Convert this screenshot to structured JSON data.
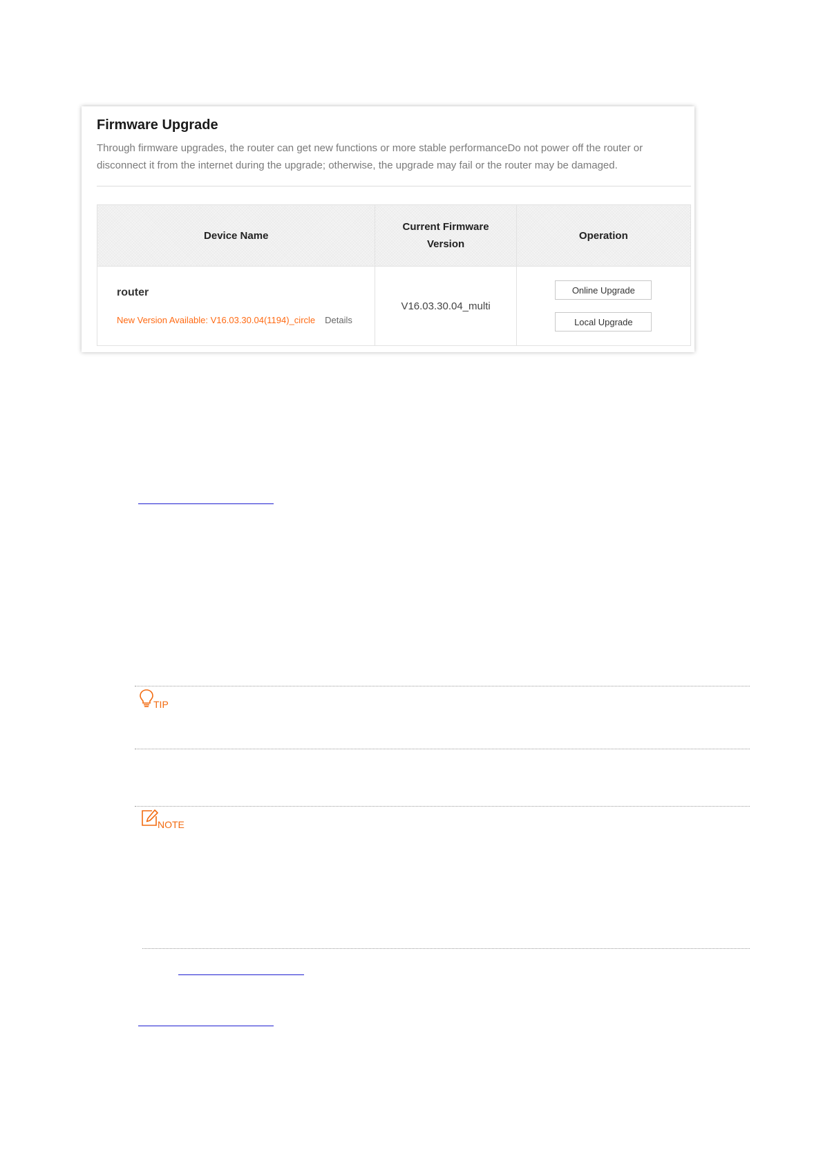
{
  "panel": {
    "title": "Firmware Upgrade",
    "description": "Through firmware upgrades, the router can get new functions or more stable performanceDo not power off the router or disconnect it from the internet during the upgrade; otherwise, the upgrade may fail or the router may be damaged."
  },
  "table": {
    "headers": {
      "device_name": "Device Name",
      "firmware_version": "Current Firmware Version",
      "operation": "Operation"
    },
    "row": {
      "device_name": "router",
      "new_version_notice": "New Version Available: V16.03.30.04(1194)_circle",
      "details_link": "Details",
      "current_version": "V16.03.30.04_multi",
      "online_upgrade_label": "Online Upgrade",
      "local_upgrade_label": "Local Upgrade"
    }
  },
  "callouts": {
    "tip_label": "TIP",
    "note_label": "NOTE"
  },
  "colors": {
    "accent": "#ff6a13",
    "link": "#1f1fd0"
  }
}
